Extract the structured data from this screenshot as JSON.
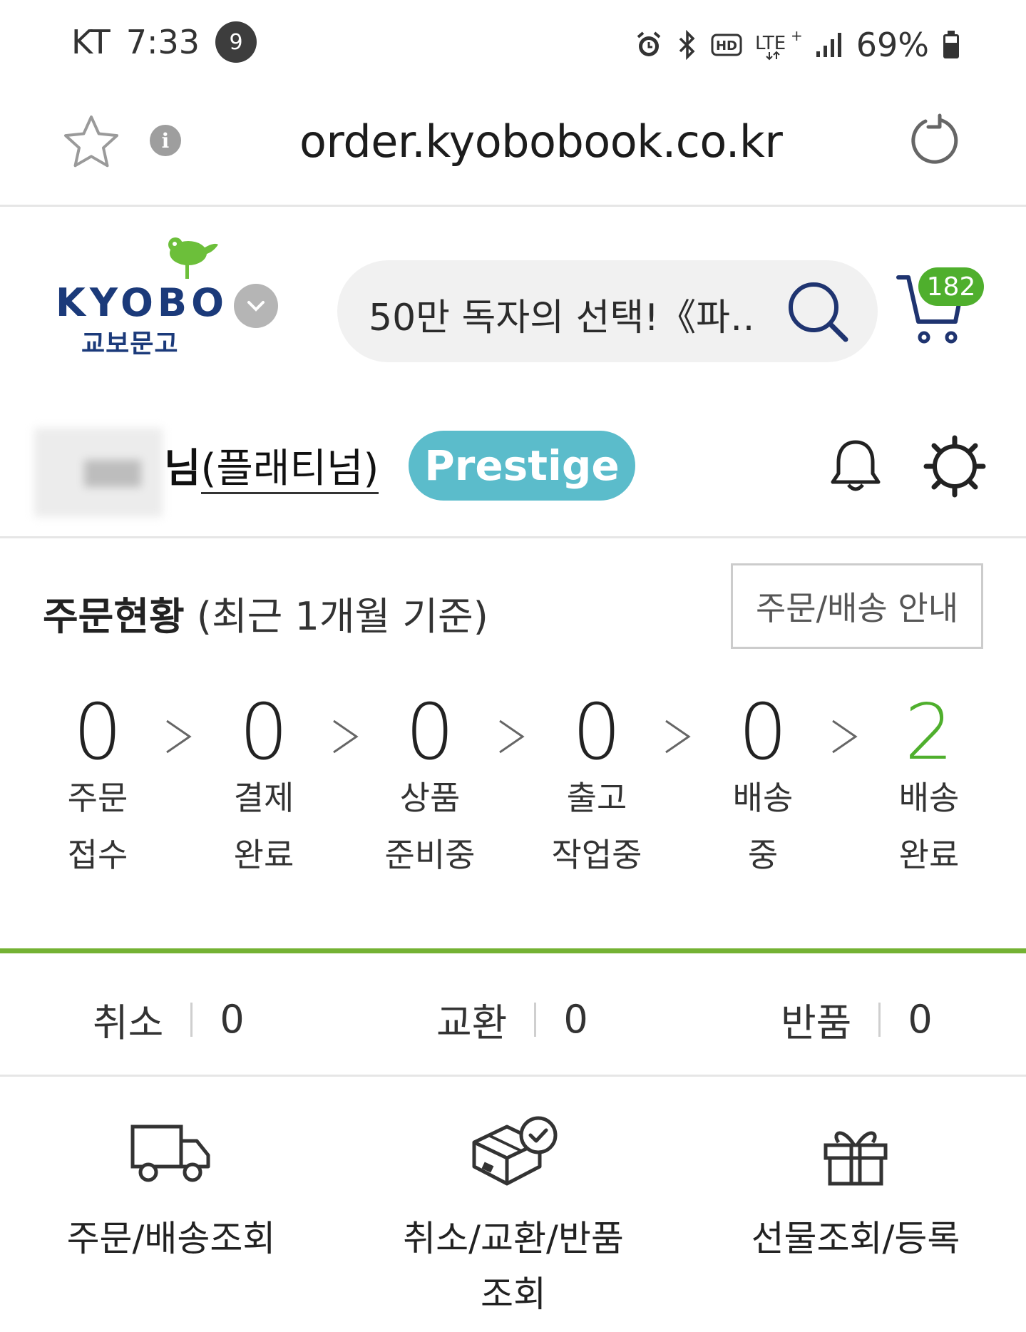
{
  "status_bar": {
    "carrier": "KT",
    "time": "7:33",
    "notification_count": "9",
    "network": "LTE",
    "battery": "69%"
  },
  "browser": {
    "url": "order.kyobobook.co.kr"
  },
  "header": {
    "logo_text": "KYOBO",
    "logo_subtext": "교보문고",
    "search_placeholder": "50만 독자의 선택!《파…",
    "cart_count": "182"
  },
  "user": {
    "name_suffix": "님",
    "grade": "(플래티넘)",
    "tier_badge": "Prestige"
  },
  "order_status": {
    "title": "주문현황",
    "subtitle": "(최근 1개월 기준)",
    "guide_button": "주문/배송 안내",
    "steps": [
      {
        "count": "0",
        "label": "주문\n접수"
      },
      {
        "count": "0",
        "label": "결제\n완료"
      },
      {
        "count": "0",
        "label": "상품\n준비중"
      },
      {
        "count": "0",
        "label": "출고\n작업중"
      },
      {
        "count": "0",
        "label": "배송\n중"
      },
      {
        "count": "2",
        "label": "배송\n완료"
      }
    ],
    "arrow_glyph": ">"
  },
  "claims": [
    {
      "label": "취소",
      "count": "0"
    },
    {
      "label": "교환",
      "count": "0"
    },
    {
      "label": "반품",
      "count": "0"
    }
  ],
  "quick_menu": [
    {
      "label": "주문/배송조회",
      "icon": "truck-icon"
    },
    {
      "label": "취소/교환/반품\n조회",
      "icon": "box-check-icon"
    },
    {
      "label": "선물조회/등록",
      "icon": "gift-icon"
    }
  ],
  "colors": {
    "brand_green": "#4faf2d",
    "divider_green": "#74b234",
    "prestige_teal": "#5bbccb",
    "logo_navy": "#1b3a7a"
  }
}
